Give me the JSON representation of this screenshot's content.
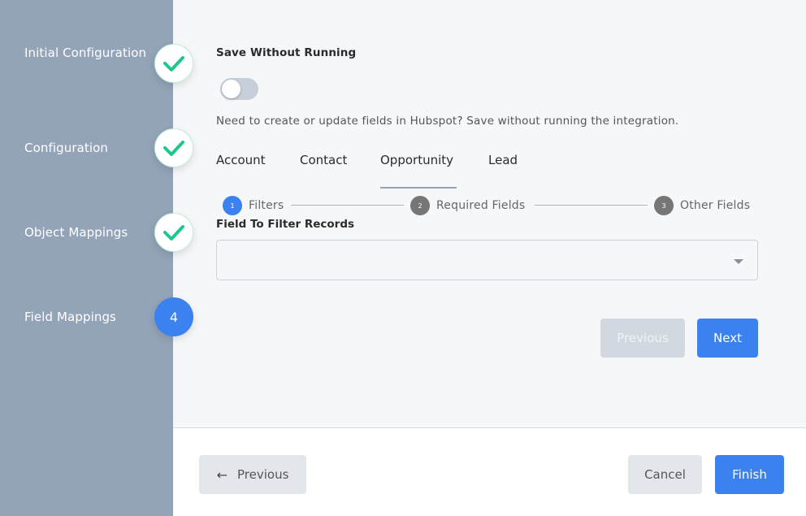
{
  "sidebar": {
    "steps": [
      {
        "label": "Initial Configuration",
        "status": "complete",
        "icon": "check-icon"
      },
      {
        "label": "Configuration",
        "status": "complete",
        "icon": "check-icon"
      },
      {
        "label": "Object Mappings",
        "status": "complete",
        "icon": "check-icon"
      },
      {
        "label": "Field Mappings",
        "status": "active",
        "number": "4"
      }
    ]
  },
  "save_without_running": {
    "title": "Save Without Running",
    "toggle_on": false,
    "helper_text": "Need to create or update fields in Hubspot? Save without running the integration."
  },
  "tabs": [
    {
      "label": "Account",
      "active": false
    },
    {
      "label": "Contact",
      "active": false
    },
    {
      "label": "Opportunity",
      "active": true
    },
    {
      "label": "Lead",
      "active": false
    }
  ],
  "stepper": [
    {
      "number": "1",
      "label": "Filters",
      "state": "active"
    },
    {
      "number": "2",
      "label": "Required Fields",
      "state": "todo"
    },
    {
      "number": "3",
      "label": "Other Fields",
      "state": "todo"
    }
  ],
  "filter": {
    "label": "Field To Filter Records",
    "value": ""
  },
  "inner_buttons": {
    "previous": "Previous",
    "next": "Next"
  },
  "footer": {
    "previous": "Previous",
    "cancel": "Cancel",
    "finish": "Finish"
  },
  "colors": {
    "accent": "#3b82f0",
    "sidebar_bg": "#93a3b8",
    "check": "#1dc88a"
  }
}
